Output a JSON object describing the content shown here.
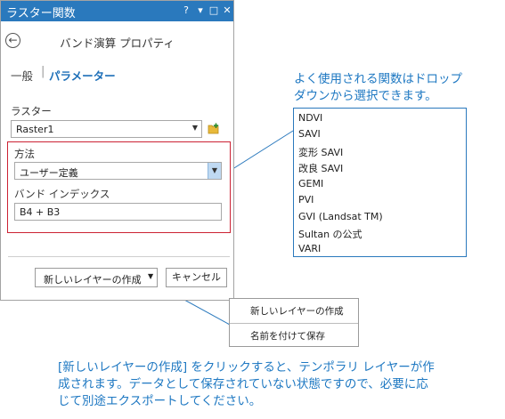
{
  "pane": {
    "title": "ラスター関数",
    "titlebar_buttons": {
      "help": "?",
      "pin": "▾",
      "maximize": "□",
      "close": "✕"
    },
    "heading": "バンド演算 プロパティ",
    "tabs": {
      "general": "一般",
      "separator": "|",
      "parameters": "パラメーター"
    }
  },
  "raster": {
    "label": "ラスター",
    "value": "Raster1"
  },
  "method": {
    "label": "方法",
    "value": "ユーザー定義"
  },
  "band_index": {
    "label": "バンド インデックス",
    "value": "B4 + B3"
  },
  "footer": {
    "new_layer_label": "新しいレイヤーの作成",
    "cancel_label": "キャンセル"
  },
  "callouts": {
    "dropdown_note_line1": "よく使用される関数はドロップ",
    "dropdown_note_line2": "ダウンから選択できます。",
    "methods": [
      "NDVI",
      "SAVI",
      "変形 SAVI",
      "改良 SAVI",
      "GEMI",
      "PVI",
      "GVI (Landsat TM)",
      "Sultan の公式",
      "VARI"
    ],
    "menu_items": [
      "新しいレイヤーの作成",
      "名前を付けて保存"
    ],
    "bottom_note_line1": "[新しいレイヤーの作成] をクリックすると、テンポラリ レイヤーが作",
    "bottom_note_line2": "成されます。データとして保存されていない状態ですので、必要に応",
    "bottom_note_line3": "じて別途エクスポートしてください。"
  },
  "colors": {
    "accent": "#2a79bd",
    "highlight_box": "#cc2233",
    "callout_text": "#1e78c2"
  }
}
